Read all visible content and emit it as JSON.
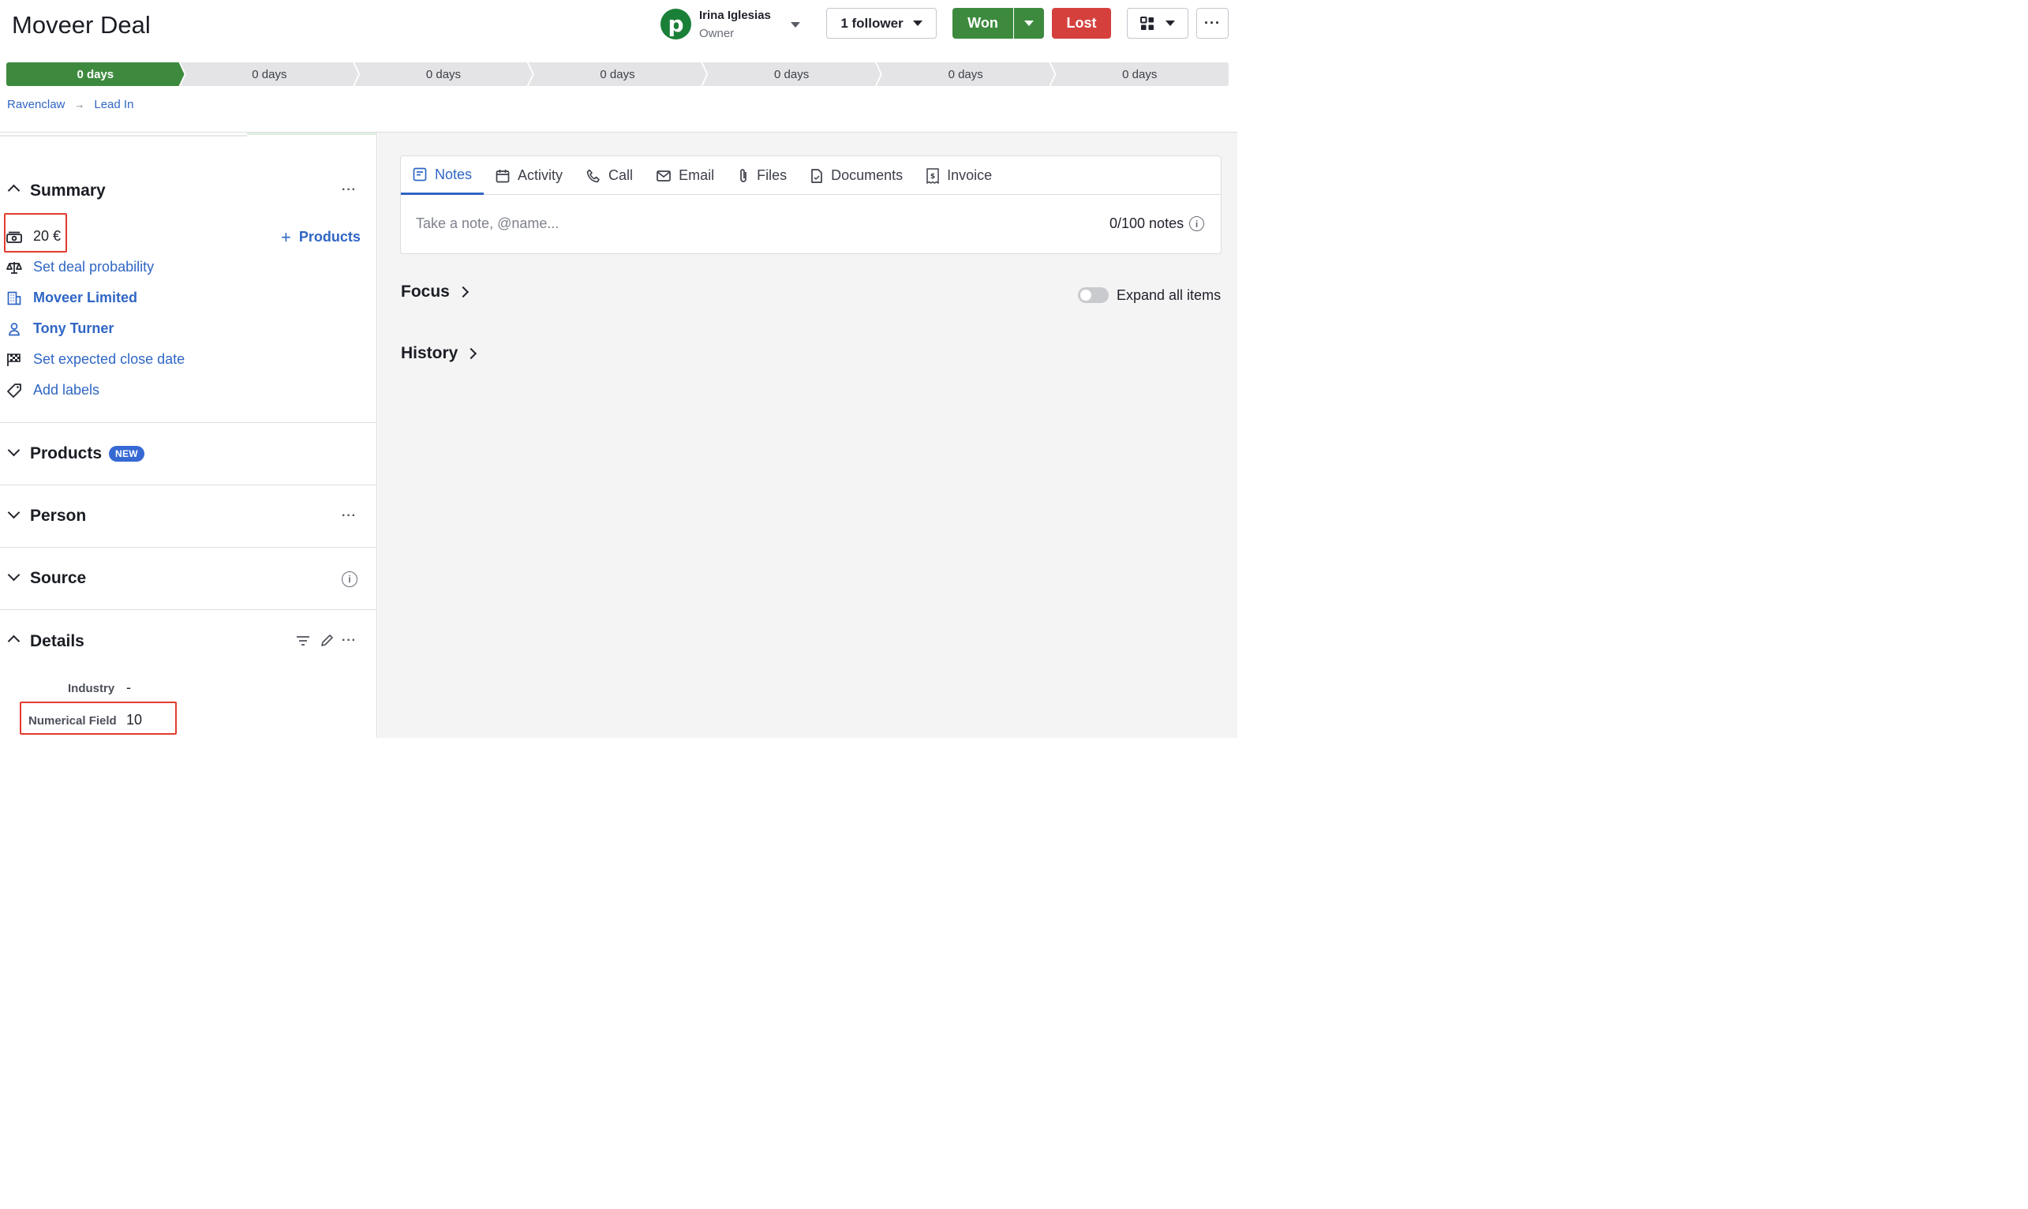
{
  "deal": {
    "title": "Moveer Deal"
  },
  "owner": {
    "name": "Irina Iglesias",
    "role": "Owner",
    "logo_letter": "p"
  },
  "actions": {
    "follower_label": "1 follower",
    "won_label": "Won",
    "lost_label": "Lost",
    "more_label": "···"
  },
  "stages": [
    {
      "label": "0 days",
      "active": true
    },
    {
      "label": "0 days"
    },
    {
      "label": "0 days"
    },
    {
      "label": "0 days"
    },
    {
      "label": "0 days"
    },
    {
      "label": "0 days"
    },
    {
      "label": "0 days"
    }
  ],
  "breadcrumb": {
    "pipeline": "Ravenclaw",
    "arrow": "→",
    "stage": "Lead In"
  },
  "summary": {
    "title": "Summary",
    "value": "20 €",
    "add_products": "Products",
    "probability": "Set deal probability",
    "organization": "Moveer Limited",
    "person": "Tony Turner",
    "close_date": "Set expected close date",
    "labels": "Add labels"
  },
  "sections": {
    "products": "Products",
    "products_badge": "NEW",
    "person": "Person",
    "source": "Source",
    "details": "Details"
  },
  "details": {
    "fields": [
      {
        "label": "Industry",
        "value": "-"
      },
      {
        "label": "Numerical Field",
        "value": "10"
      }
    ]
  },
  "tabs": [
    "Notes",
    "Activity",
    "Call",
    "Email",
    "Files",
    "Documents",
    "Invoice"
  ],
  "notes": {
    "placeholder": "Take a note, @name...",
    "count": "0/100 notes"
  },
  "feed": {
    "focus": "Focus",
    "history": "History",
    "expand_label": "Expand all items"
  },
  "colors": {
    "won": "#3d8a3f",
    "lost": "#d5403d",
    "link": "#2f66c4",
    "highlight": "#e23b2e"
  }
}
